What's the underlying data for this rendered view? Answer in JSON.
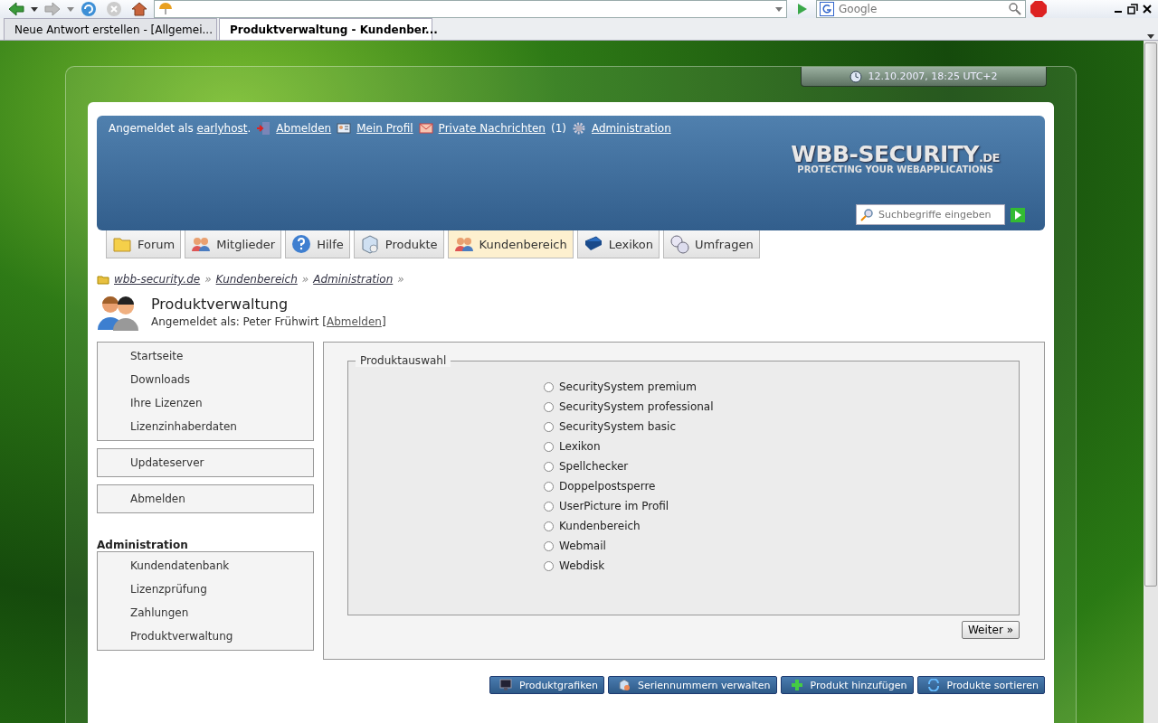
{
  "browser": {
    "search_placeholder": "Google",
    "tabs": [
      {
        "label": "Neue Antwort erstellen - [Allgemei...",
        "selected": false
      },
      {
        "label": "Produktverwaltung - Kundenber...",
        "selected": true
      }
    ]
  },
  "clock": "12.10.2007, 18:25 UTC+2",
  "header": {
    "user_prefix": "Angemeldet als",
    "username": "earlyhost",
    "user_suffix": ".",
    "links": [
      {
        "label": "Abmelden",
        "kind": "exit"
      },
      {
        "label": "Mein Profil",
        "kind": "profile"
      },
      {
        "label": "Private Nachrichten",
        "kind": "mail",
        "count": "(1)"
      },
      {
        "label": "Administration",
        "kind": "gear"
      }
    ],
    "logo": {
      "name": "WBB-SECURITY",
      "suffix": ".DE",
      "tagline": "PROTECTING YOUR WEBAPPLICATIONS"
    },
    "search_placeholder": "Suchbegriffe eingeben"
  },
  "nav": [
    {
      "label": "Forum",
      "kind": "folder",
      "selected": false
    },
    {
      "label": "Mitglieder",
      "kind": "users",
      "selected": false
    },
    {
      "label": "Hilfe",
      "kind": "help",
      "selected": false
    },
    {
      "label": "Produkte",
      "kind": "box",
      "selected": false
    },
    {
      "label": "Kundenbereich",
      "kind": "users",
      "selected": true
    },
    {
      "label": "Lexikon",
      "kind": "book",
      "selected": false
    },
    {
      "label": "Umfragen",
      "kind": "poll",
      "selected": false
    }
  ],
  "breadcrumb": {
    "items": [
      "wbb-security.de",
      "Kundenbereich",
      "Administration"
    ],
    "separator": "»"
  },
  "page": {
    "title": "Produktverwaltung",
    "login_text": "Angemeldet als: Peter Frühwirt",
    "bracket_open": "[",
    "login_link": "Abmelden",
    "bracket_close": "]"
  },
  "sidebar": [
    {
      "items": [
        "Startseite",
        "Downloads",
        "Ihre Lizenzen",
        "Lizenzinhaberdaten"
      ]
    },
    {
      "items": [
        "Updateserver"
      ]
    },
    {
      "items": [
        "Abmelden"
      ]
    },
    {
      "heading": "Administration",
      "items": [
        "Kundendatenbank",
        "Lizenzprüfung",
        "Zahlungen",
        "Produktverwaltung"
      ]
    }
  ],
  "form": {
    "legend": "Produktauswahl",
    "options": [
      {
        "label": "SecuritySystem premium",
        "selected": false
      },
      {
        "label": "SecuritySystem professional",
        "selected": false
      },
      {
        "label": "SecuritySystem basic",
        "selected": false
      },
      {
        "label": "Lexikon",
        "selected": false
      },
      {
        "label": "Spellchecker",
        "selected": false
      },
      {
        "label": "Doppelpostsperre",
        "selected": false
      },
      {
        "label": "UserPicture im Profil",
        "selected": false
      },
      {
        "label": "Kundenbereich",
        "selected": false
      },
      {
        "label": "Webmail",
        "selected": false
      },
      {
        "label": "Webdisk",
        "selected": false
      }
    ],
    "submit": "Weiter »"
  },
  "actions": [
    {
      "label": "Produktgrafiken",
      "kind": "monitor"
    },
    {
      "label": "Seriennummern verwalten",
      "kind": "box"
    },
    {
      "label": "Produkt hinzufügen",
      "kind": "plus"
    },
    {
      "label": "Produkte sortieren",
      "kind": "refresh"
    }
  ]
}
